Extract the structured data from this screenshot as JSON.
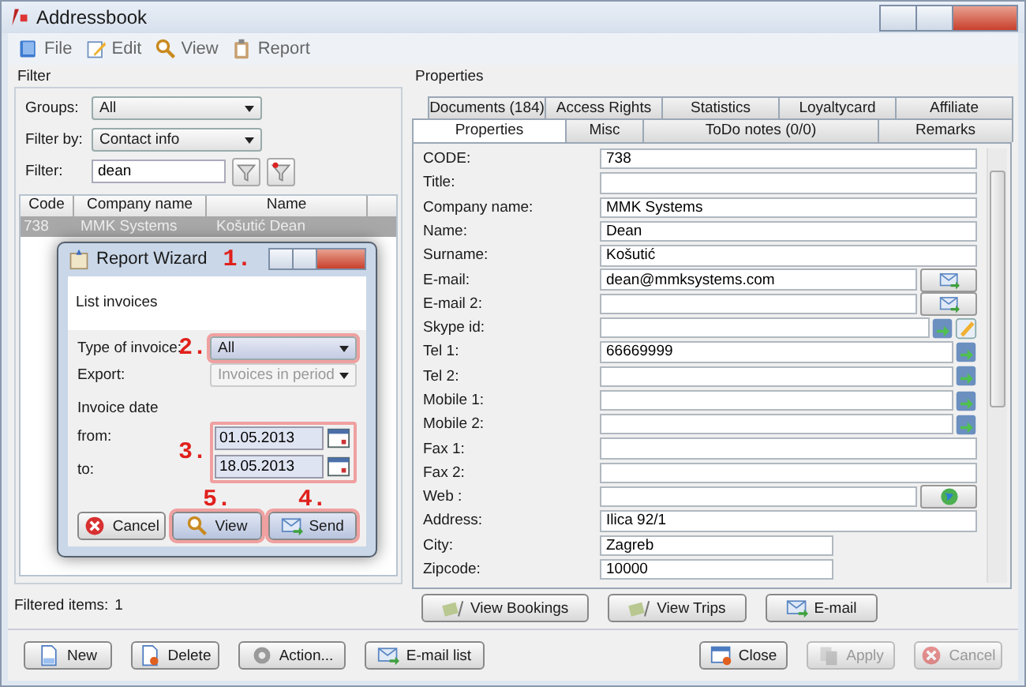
{
  "window": {
    "title": "Addressbook"
  },
  "menu": [
    {
      "label": "File"
    },
    {
      "label": "Edit"
    },
    {
      "label": "View"
    },
    {
      "label": "Report"
    }
  ],
  "filter": {
    "title": "Filter",
    "groups": {
      "label": "Groups:",
      "value": "All"
    },
    "filter_by": {
      "label": "Filter by:",
      "value": "Contact info"
    },
    "filter": {
      "label": "Filter:",
      "value": "dean"
    }
  },
  "table": {
    "columns": [
      "Code",
      "Company name",
      "Name"
    ],
    "rows": [
      {
        "cells": [
          "738",
          "MMK Systems",
          "Košutić Dean"
        ],
        "selected": true
      }
    ]
  },
  "filtered_items": {
    "label": "Filtered items:",
    "value": "1"
  },
  "left_buttons": [
    {
      "label": "New"
    },
    {
      "label": "Delete"
    },
    {
      "label": "Action..."
    },
    {
      "label": "E-mail list"
    }
  ],
  "properties": {
    "title": "Properties",
    "tab_rows": [
      [
        {
          "label": "Documents (184)",
          "selected": false
        },
        {
          "label": "Access Rights",
          "selected": false
        },
        {
          "label": "Statistics",
          "selected": false
        },
        {
          "label": "Loyaltycard",
          "selected": false
        },
        {
          "label": "Affiliate",
          "selected": false
        }
      ],
      [
        {
          "label": "Properties",
          "selected": true
        },
        {
          "label": "Misc",
          "selected": false
        },
        {
          "label": "ToDo notes (0/0)",
          "selected": false
        },
        {
          "label": "Remarks",
          "selected": false
        }
      ]
    ],
    "fields": [
      {
        "label": "CODE:",
        "value": "738",
        "kind": "text"
      },
      {
        "label": "Title:",
        "kind": "text"
      },
      {
        "label": "Company name:",
        "value": "MMK Systems",
        "kind": "text"
      },
      {
        "label": "Name:",
        "value": "Dean",
        "kind": "text"
      },
      {
        "label": "Surname:",
        "value": "Košutić",
        "kind": "text"
      },
      {
        "label": "E-mail:",
        "value": "dean@mmksystems.com",
        "kind": "mail"
      },
      {
        "label": "E-mail 2:",
        "kind": "mail"
      },
      {
        "label": "Skype id:",
        "kind": "skype"
      },
      {
        "label": "Tel 1:",
        "value": "66669999",
        "kind": "phone"
      },
      {
        "label": "Tel 2:",
        "kind": "phone"
      },
      {
        "label": "Mobile 1:",
        "kind": "phone"
      },
      {
        "label": "Mobile 2:",
        "kind": "phone"
      },
      {
        "label": "Fax 1:",
        "kind": "text"
      },
      {
        "label": "Fax 2:",
        "kind": "text"
      },
      {
        "label": "Web :",
        "kind": "web"
      },
      {
        "label": "Address:",
        "value": "Ilica 92/1",
        "kind": "text"
      },
      {
        "label": "City:",
        "value": "Zagreb",
        "kind": "short"
      },
      {
        "label": "Zipcode:",
        "value": "10000",
        "kind": "short"
      }
    ],
    "buttons": [
      {
        "label": "View Bookings"
      },
      {
        "label": "View Trips"
      },
      {
        "label": "E-mail"
      }
    ]
  },
  "footer_buttons": [
    {
      "label": "Close",
      "disabled": false
    },
    {
      "label": "Apply",
      "disabled": true
    },
    {
      "label": "Cancel",
      "disabled": true
    }
  ],
  "wizard": {
    "title": "Report Wizard",
    "title_marker": "1.",
    "header": "List invoices",
    "type": {
      "label": "Type of invoice:",
      "value": "All",
      "marker": "2.",
      "highlighted": true
    },
    "export": {
      "label": "Export:",
      "value": "Invoices in period",
      "disabled": true
    },
    "date_label": "Invoice date",
    "date_marker": "3.",
    "from": {
      "label": "from:",
      "value": "01.05.2013"
    },
    "to": {
      "label": "to:",
      "value": "18.05.2013"
    },
    "buttons": [
      {
        "label": "Cancel",
        "highlighted": false
      },
      {
        "label": "View",
        "marker": "5.",
        "highlighted": true
      },
      {
        "label": "Send",
        "marker": "4.",
        "highlighted": true
      }
    ]
  }
}
